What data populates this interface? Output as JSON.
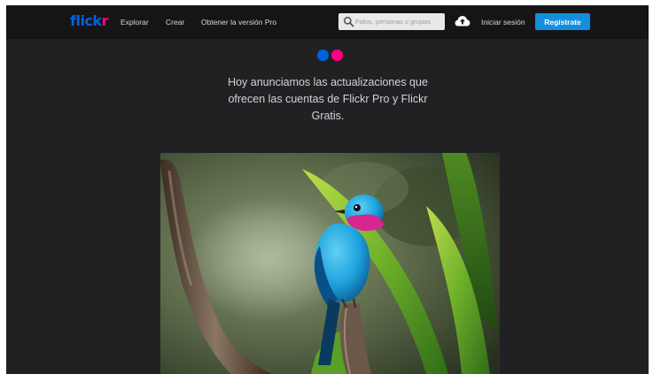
{
  "header": {
    "logo_part1": "flick",
    "logo_part2": "r",
    "nav": {
      "explore": "Explorar",
      "create": "Crear",
      "get_pro": "Obtener la versión Pro"
    },
    "search": {
      "placeholder": "Fotos, personas o grupos"
    },
    "signin_label": "Iniciar sesión",
    "register_label": "Regístrate"
  },
  "main": {
    "announcement": "Hoy anunciamos las actualizaciones que ofrecen las cuentas de Flickr Pro y Flickr Gratis."
  },
  "icons": {
    "search": "search-icon",
    "upload": "cloud-upload-icon",
    "brand_dots": "flickr-dots-logo"
  },
  "colors": {
    "background": "#212124",
    "topbar": "#151517",
    "brand_blue": "#0063dc",
    "brand_pink": "#ff0084",
    "button": "#128fdc"
  }
}
